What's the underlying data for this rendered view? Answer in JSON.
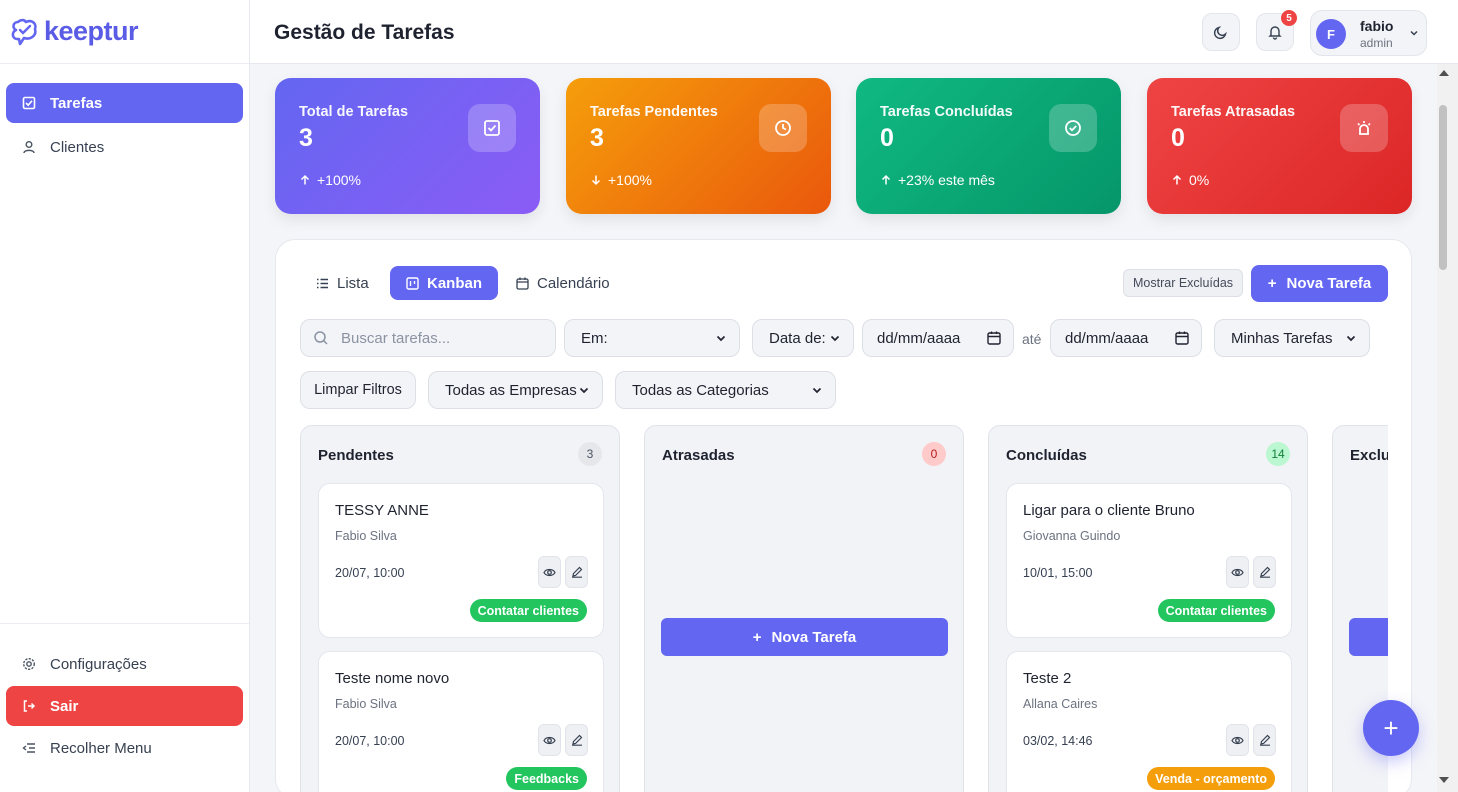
{
  "app": {
    "name": "keeptur"
  },
  "sidebar": {
    "items": [
      {
        "label": "Tarefas",
        "icon": "checkbox-icon"
      },
      {
        "label": "Clientes",
        "icon": "user-icon"
      }
    ],
    "bottom": [
      {
        "label": "Configurações",
        "icon": "gear-icon"
      },
      {
        "label": "Sair",
        "icon": "logout-icon"
      },
      {
        "label": "Recolher Menu",
        "icon": "collapse-icon"
      }
    ]
  },
  "header": {
    "title": "Gestão de Tarefas",
    "notifications": "5",
    "user": {
      "initial": "F",
      "name": "fabio",
      "role": "admin"
    }
  },
  "stats": [
    {
      "title": "Total de Tarefas",
      "value": "3",
      "delta": "+100%",
      "icon": "task-icon",
      "color": "#6c5ce7"
    },
    {
      "title": "Tarefas Pendentes",
      "value": "3",
      "delta": "+100%",
      "icon": "clock-icon",
      "color": "#f08a0c"
    },
    {
      "title": "Tarefas Concluídas",
      "value": "0",
      "delta": "+23% este mês",
      "icon": "check-circle-icon",
      "color": "#11a36f"
    },
    {
      "title": "Tarefas Atrasadas",
      "value": "0",
      "delta": "0%",
      "icon": "alarm-icon",
      "color": "#e8353a"
    }
  ],
  "tabs": [
    "Lista",
    "Kanban",
    "Calendário"
  ],
  "toolbar": {
    "show_deleted": "Mostrar Excluídas",
    "new_task": "Nova Tarefa"
  },
  "filters": {
    "search_placeholder": "Buscar tarefas...",
    "em": "Em:",
    "data_de": "Data de:",
    "date_placeholder": "dd/mm/aaaa",
    "ate": "até",
    "minhas": "Minhas Tarefas",
    "limpar": "Limpar Filtros",
    "empresas": "Todas as Empresas",
    "categorias": "Todas as Categorias"
  },
  "kanban": {
    "columns": [
      {
        "title": "Pendentes",
        "count": "3",
        "cards": [
          {
            "title": "TESSY ANNE",
            "assignee": "Fabio Silva",
            "date": "20/07, 10:00",
            "tag": "Contatar clientes",
            "tag_color": "#22c55e"
          },
          {
            "title": "Teste nome novo",
            "assignee": "Fabio Silva",
            "date": "20/07, 10:00",
            "tag": "Feedbacks",
            "tag_color": "#22c55e"
          }
        ]
      },
      {
        "title": "Atrasadas",
        "count": "0",
        "new_task": "Nova Tarefa"
      },
      {
        "title": "Concluídas",
        "count": "14",
        "cards": [
          {
            "title": "Ligar para o cliente Bruno",
            "assignee": "Giovanna Guindo",
            "date": "10/01, 15:00",
            "tag": "Contatar clientes",
            "tag_color": "#22c55e"
          },
          {
            "title": "Teste 2",
            "assignee": "Allana Caires",
            "date": "03/02, 14:46",
            "tag": "Venda - orçamento",
            "tag_color": "#f59e0b"
          }
        ]
      },
      {
        "title": "Exclui"
      }
    ]
  },
  "fab": "+"
}
